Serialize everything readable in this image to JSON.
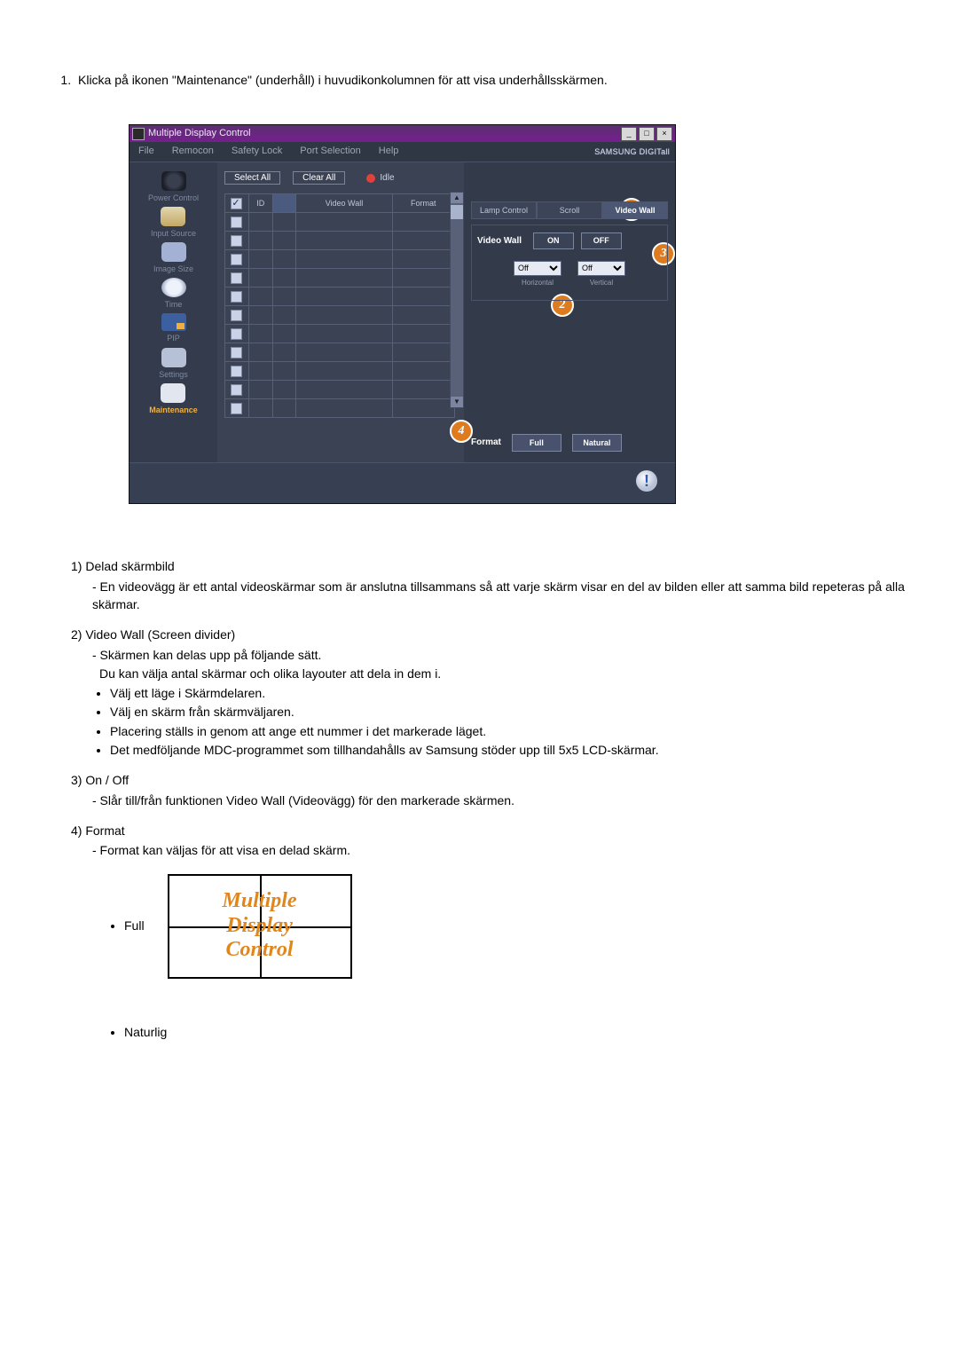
{
  "intro": "Klicka på ikonen \"Maintenance\" (underhåll) i huvudikonkolumnen för att visa underhållsskärmen.",
  "window": {
    "title": "Multiple Display Control",
    "menu": {
      "file": "File",
      "remocon": "Remocon",
      "safety": "Safety Lock",
      "port": "Port Selection",
      "help": "Help"
    },
    "brand": "SAMSUNG DIGITall",
    "win_btns": {
      "min": "_",
      "max": "□",
      "close": "×"
    }
  },
  "sidebar": {
    "power": "Power Control",
    "input": "Input Source",
    "image": "Image Size",
    "time": "Time",
    "pip": "PIP",
    "settings": "Settings",
    "maint": "Maintenance"
  },
  "toolbar": {
    "select_all": "Select All",
    "clear_all": "Clear All",
    "idle": "Idle"
  },
  "grid": {
    "h_id": "ID",
    "h_vw": "Video Wall",
    "h_fmt": "Format",
    "first_id": "ID"
  },
  "panel": {
    "tabs": {
      "lamp": "Lamp Control",
      "scroll": "Scroll",
      "videowall": "Video Wall"
    },
    "vw_label": "Video Wall",
    "on": "ON",
    "off": "OFF",
    "dd_h": "Off",
    "dd_v": "Off",
    "dd_hl": "Horizontal",
    "dd_vl": "Vertical",
    "format_label": "Format",
    "full": "Full",
    "natural": "Natural"
  },
  "markers": {
    "m1": "1",
    "m2": "2",
    "m3": "3",
    "m4": "4"
  },
  "expl": {
    "t1": "1) Delad skärmbild",
    "t1a": "- En videovägg är ett antal videoskärmar som är anslutna tillsammans så att varje skärm visar en del av bilden eller att samma bild repeteras på alla skärmar.",
    "t2": "2) Video Wall (Screen divider)",
    "t2a": "- Skärmen kan delas upp på följande sätt.",
    "t2b": "Du kan välja antal skärmar och olika layouter att dela in dem i.",
    "b21": "Välj ett läge i Skärmdelaren.",
    "b22": "Välj en skärm från skärmväljaren.",
    "b23": "Placering ställs in genom att ange ett nummer i det markerade läget.",
    "b24": "Det medföljande MDC-programmet som tillhandahålls av Samsung stöder upp till 5x5 LCD-skärmar.",
    "t3": "3) On / Off",
    "t3a": "- Slår till/från funktionen Video Wall (Videovägg) för den markerade skärmen.",
    "t4": "4) Format",
    "t4a": "- Format kan väljas för att visa en delad skärm.",
    "full_label": "Full",
    "nat_label": "Naturlig",
    "demo_l1": "Multiple",
    "demo_l2": "Display",
    "demo_l3": "Control"
  }
}
